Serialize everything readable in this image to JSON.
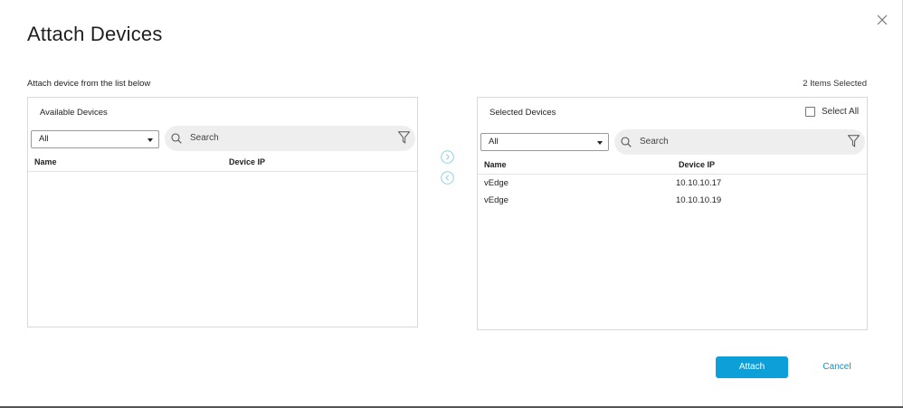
{
  "dialog": {
    "title": "Attach Devices",
    "subtitle": "Attach device from the list below",
    "selected_count": "2 Items Selected",
    "close_icon": "close-icon"
  },
  "available": {
    "title": "Available Devices",
    "filter_value": "All",
    "search_placeholder": "Search",
    "columns": [
      "Name",
      "Device IP"
    ],
    "rows": []
  },
  "selected": {
    "title": "Selected Devices",
    "select_all_label": "Select All",
    "filter_value": "All",
    "search_placeholder": "Search",
    "columns": [
      "Name",
      "Device IP"
    ],
    "rows": [
      {
        "name": "vEdge",
        "ip": "10.10.10.17"
      },
      {
        "name": "vEdge",
        "ip": "10.10.10.19"
      }
    ]
  },
  "transfer": {
    "move_right_icon": "chevron-right-circle-icon",
    "move_left_icon": "chevron-left-circle-icon"
  },
  "footer": {
    "attach_label": "Attach",
    "cancel_label": "Cancel"
  },
  "colors": {
    "accent": "#0d9fd8",
    "link": "#0d8fcf"
  }
}
